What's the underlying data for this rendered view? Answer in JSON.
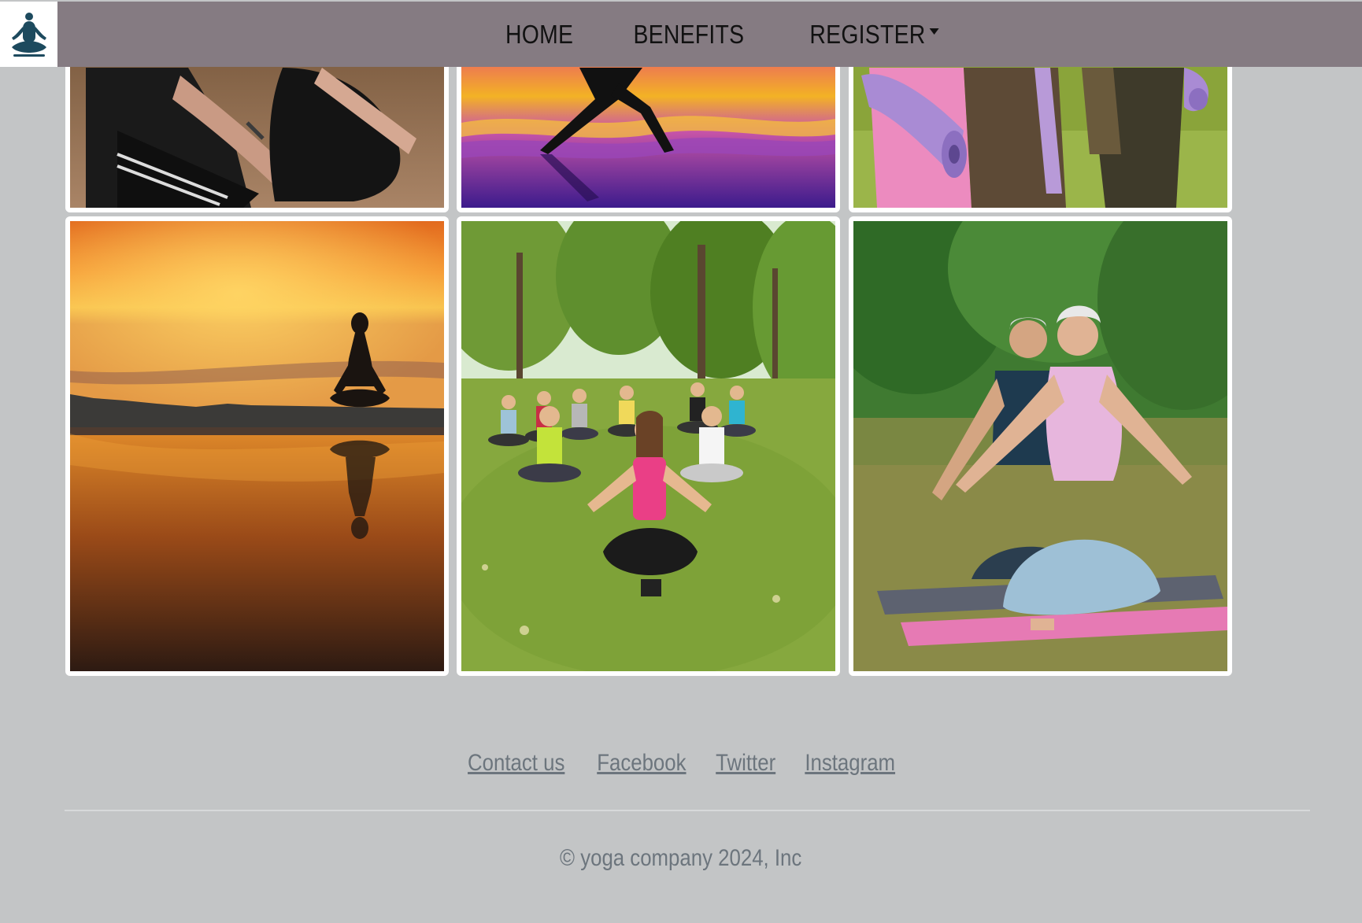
{
  "navbar": {
    "logo_icon": "meditation-figure-icon",
    "links": [
      {
        "label": "HOME"
      },
      {
        "label": "BENEFITS"
      },
      {
        "label": "REGISTER",
        "has_dropdown": true
      }
    ],
    "background": "#857b82"
  },
  "gallery": {
    "images": [
      {
        "subject": "kneeling-yoga-pose-photo"
      },
      {
        "subject": "warrior-pose-sunset-photo"
      },
      {
        "subject": "yoga-mats-on-grass-photo"
      },
      {
        "subject": "meditation-silhouette-lake-photo"
      },
      {
        "subject": "group-meditation-park-photo"
      },
      {
        "subject": "elderly-couple-meditation-photo"
      }
    ]
  },
  "footer": {
    "links": [
      "Contact us",
      "Facebook",
      "Twitter",
      "Instagram"
    ],
    "copyright": "© yoga company 2024, Inc"
  },
  "colors": {
    "page_background": "#c3c5c6",
    "footer_text": "#6c757d",
    "logo_figure": "#1d4a5e"
  }
}
